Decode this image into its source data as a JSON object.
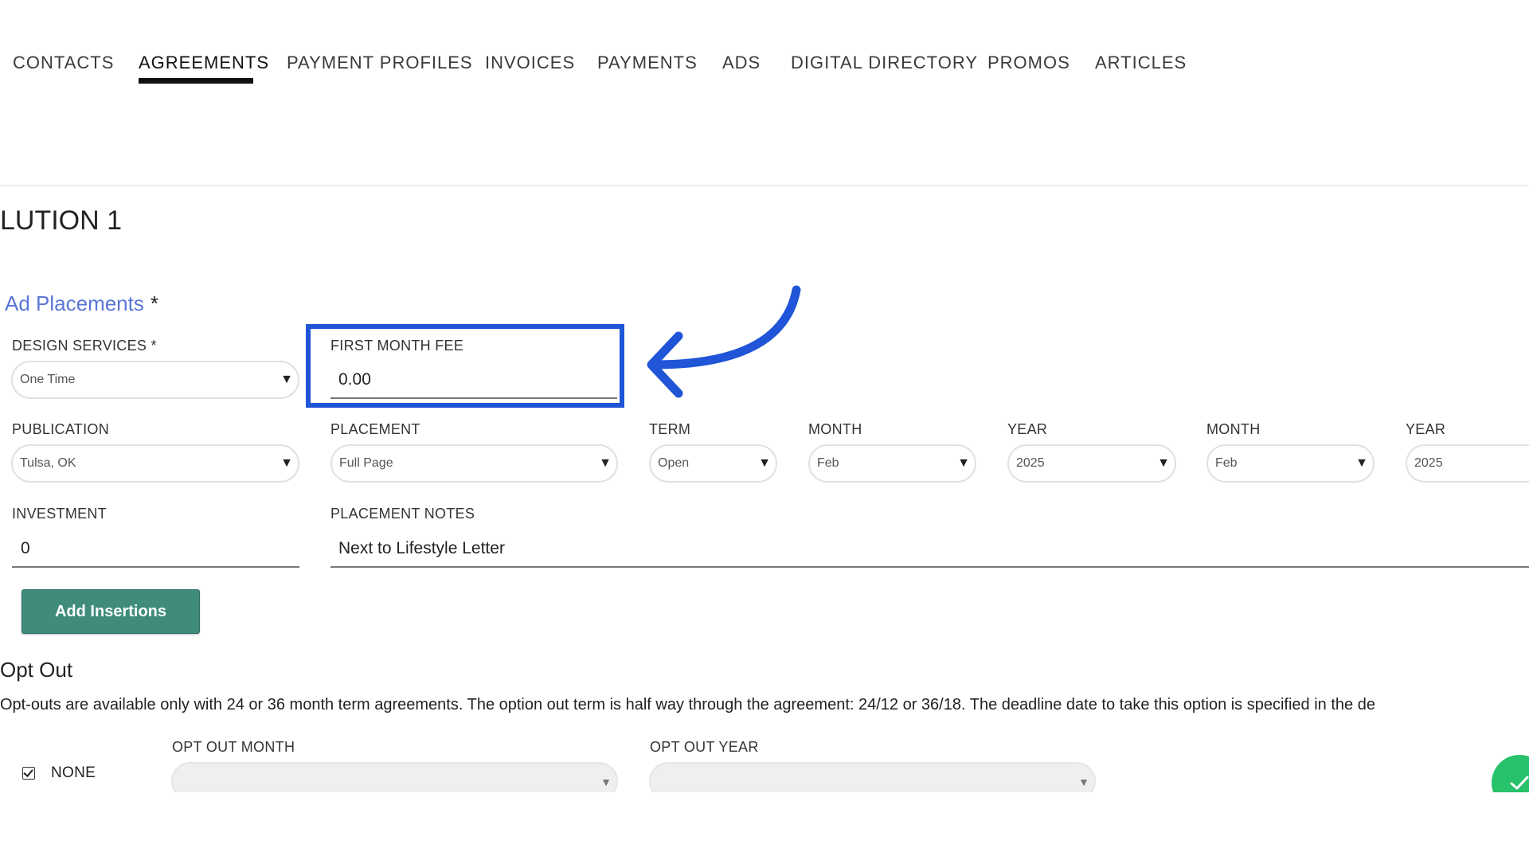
{
  "nav": {
    "tabs": [
      {
        "label": "CONTACTS",
        "active": false
      },
      {
        "label": "AGREEMENTS",
        "active": true
      },
      {
        "label": "PAYMENT PROFILES",
        "active": false
      },
      {
        "label": "INVOICES",
        "active": false
      },
      {
        "label": "PAYMENTS",
        "active": false
      },
      {
        "label": "ADS",
        "active": false
      },
      {
        "label": "DIGITAL DIRECTORY",
        "active": false
      },
      {
        "label": "PROMOS",
        "active": false
      },
      {
        "label": "ARTICLES",
        "active": false
      }
    ]
  },
  "solution": {
    "title": "LUTION 1"
  },
  "ad_placements": {
    "heading": "Ad Placements",
    "required_mark": "*"
  },
  "form": {
    "design_services": {
      "label": "DESIGN SERVICES *",
      "value": "One Time"
    },
    "first_month_fee": {
      "label": "FIRST MONTH FEE",
      "value": "0.00"
    },
    "publication": {
      "label": "PUBLICATION",
      "value": "Tulsa, OK"
    },
    "placement": {
      "label": "PLACEMENT",
      "value": "Full Page"
    },
    "term": {
      "label": "TERM",
      "value": "Open"
    },
    "start_month": {
      "label": "MONTH",
      "value": "Feb"
    },
    "start_year": {
      "label": "YEAR",
      "value": "2025"
    },
    "end_month": {
      "label": "MONTH",
      "value": "Feb"
    },
    "end_year": {
      "label": "YEAR",
      "value": "2025"
    },
    "investment": {
      "label": "INVESTMENT",
      "value": "0"
    },
    "placement_notes": {
      "label": "PLACEMENT NOTES",
      "value": "Next to Lifestyle Letter"
    }
  },
  "buttons": {
    "add_insertions": "Add Insertions"
  },
  "opt_out": {
    "title": "Opt Out",
    "description": "Opt-outs are available only with 24 or 36 month term agreements. The option out term is half way through the agreement: 24/12 or 36/18. The deadline date to take this option is specified in the de",
    "none_label": "NONE",
    "none_checked": true,
    "month_label": "OPT OUT MONTH",
    "month_value": "",
    "year_label": "OPT OUT YEAR",
    "year_value": ""
  },
  "icons": {
    "caret": "▼",
    "annotation": "curved-arrow-icon",
    "save": "checkmark-icon"
  },
  "colors": {
    "accent_blue": "#1f55d6",
    "link_blue": "#5b75d6",
    "button_green": "#3f8c7c",
    "save_green": "#27c26a"
  }
}
